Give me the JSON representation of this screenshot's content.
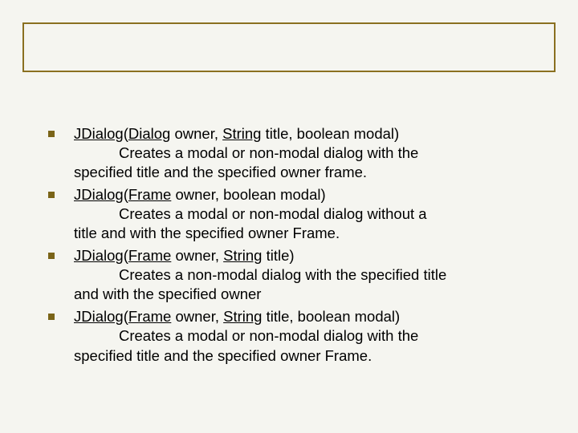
{
  "items": [
    {
      "sig_before": "",
      "link1": "JDialog",
      "sig_mid1": "(",
      "link2": "Dialog",
      "sig_mid2": " owner, ",
      "link3": "String",
      "sig_after": " title, boolean modal)",
      "desc_first": "Creates a modal or non-modal dialog with the",
      "desc_rest": "specified title and the specified owner frame."
    },
    {
      "sig_before": "",
      "link1": "JDialog",
      "sig_mid1": "(",
      "link2": "Frame",
      "sig_mid2": " owner, boolean modal)",
      "link3": "",
      "sig_after": "",
      "desc_first": "Creates a modal or non-modal dialog without a",
      "desc_rest": "title and with the specified owner Frame."
    },
    {
      "sig_before": "",
      "link1": "JDialog",
      "sig_mid1": "(",
      "link2": "Frame",
      "sig_mid2": " owner, ",
      "link3": "String",
      "sig_after": " title)",
      "desc_first": "Creates a non-modal dialog with the specified title",
      "desc_rest": "and with the specified owner"
    },
    {
      "sig_before": "",
      "link1": "JDialog",
      "sig_mid1": "(",
      "link2": "Frame",
      "sig_mid2": " owner, ",
      "link3": "String",
      "sig_after": " title, boolean modal)",
      "desc_first": "Creates a modal or non-modal dialog with the",
      "desc_rest": "specified title and the specified owner Frame."
    }
  ]
}
